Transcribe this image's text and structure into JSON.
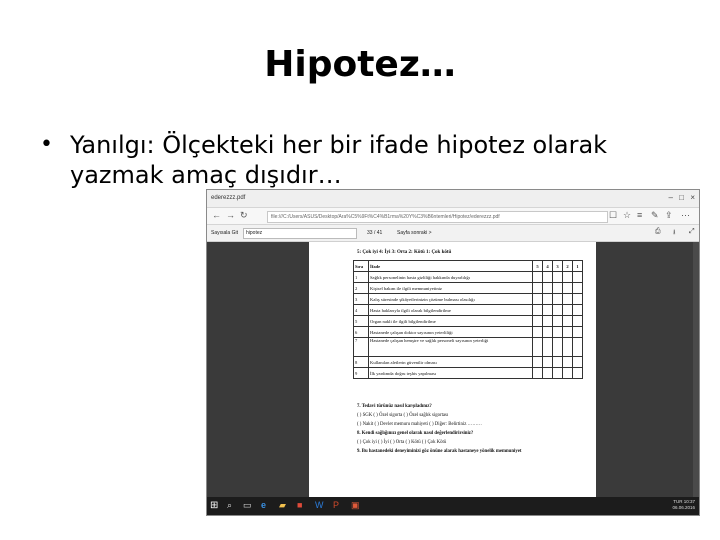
{
  "slide": {
    "title": "Hipotez…",
    "bullet_symbol": "•",
    "bullet_text": "Yanılgı: Ölçekteki her bir ifade hipotez olarak yazmak amaç dışıdır…"
  },
  "screenshot": {
    "browser": {
      "tab_title": "ederezzz.pdf",
      "address": "file:///C:/Users/ASUS/Desktop/Ara%C5%9Ft%C4%B1rma%20Y%C3%B6ntemleri/Hipotez/ederezzz.pdf"
    },
    "pdf_toolbar": {
      "search_label": "Sayısala Git",
      "search_value": "hipotez",
      "page_indicator": "33 / 41",
      "next_label": "Sayfa sonraki >"
    },
    "document": {
      "scale_legend": "5: Çok iyi   4: İyi   3: Orta   2: Kötü   1: Çok kötü",
      "table_header": [
        "Sıra",
        "İfade",
        "5",
        "4",
        "3",
        "2",
        "1"
      ],
      "rows": [
        {
          "no": "1",
          "text": "Sağlık personelinin hasta gizliliği hakkında duyarlılığı"
        },
        {
          "no": "2",
          "text": "Kişisel bakım ile ilgili memnuniyetiniz"
        },
        {
          "no": "3",
          "text": "Kalış süresinde şikâyetlerinizin çözüme bulması olasılığı"
        },
        {
          "no": "4",
          "text": "Hasta haklarıyla ilgili olarak bilgilendirilme"
        },
        {
          "no": "5",
          "text": "Organ nakli ile ilgili bilgilendirilme"
        },
        {
          "no": "6",
          "text": "Hastanede çalışan doktor sayısının yeterliliği"
        },
        {
          "no": "7",
          "text": "Hastanede çalışan hemşire ve sağlık personeli sayısının yeterliği"
        },
        {
          "no": "8",
          "text": "Kullanılan aletlerin güvenilir olması"
        },
        {
          "no": "9",
          "text": "İlk yardımda doğru teşhis yapılması"
        }
      ],
      "q7_title": "7. Tedavi türünüz nasıl karşıladınız?",
      "q7_opt1": "(   ) SGK         (   ) Özel sigorta    (   ) Özel sağlık sigortası",
      "q7_opt2": "(   ) Nakit        (   ) Devlet memuru mahiyeti   (   ) Diğer: Belirtiniz ………",
      "q8_title": "8. Kendi sağlığınızı genel olarak nasıl değerlendirirsiniz?",
      "q8_opts": "(   ) Çok iyi    (   ) İyi    (   ) Orta    (   ) Kötü    (   ) Çok Kötü",
      "q9_title": "9. Bu hastanedeki deneyiminizi göz önüne alarak hastaneye yönelik memnuniyet"
    },
    "taskbar": {
      "tray_time": "10:37",
      "tray_date": "06.06.2016",
      "tray_lang": "TUR"
    }
  }
}
